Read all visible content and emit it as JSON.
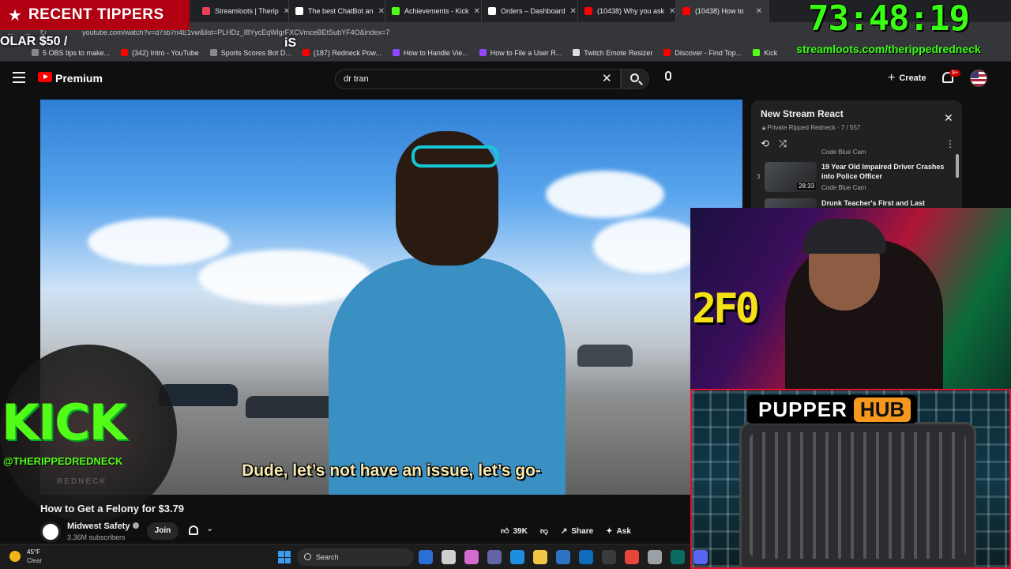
{
  "overlay": {
    "tippers_title": "RECENT TIPPERS",
    "tipper_amount": "OLAR $50 /",
    "tipper_fragment": "iS",
    "timer": "73:48:19",
    "timer_url": "streamloots.com/therippedredneck"
  },
  "browser": {
    "tabs": [
      {
        "label": "Streamloots | Therip",
        "color": "#e84057"
      },
      {
        "label": "The best ChatBot an",
        "color": "#ffffff"
      },
      {
        "label": "Achievements - Kick",
        "color": "#53fc18"
      },
      {
        "label": "Orders – Dashboard",
        "color": "#ffffff"
      },
      {
        "label": "(10438) Why you ask",
        "color": "#ff0000"
      },
      {
        "label": "(10438) How to",
        "color": "#ff0000"
      }
    ],
    "url": "youtube.com/watch?v=d7sb7n4E1vw&list=PLHDz_I8YycEqWlgrFXCVmceBEtSubYF4O&index=7",
    "bookmarks": [
      {
        "label": "5 OBS tips to make...",
        "color": "#888888"
      },
      {
        "label": "(342) Intro - YouTube",
        "color": "#ff0000"
      },
      {
        "label": "Sports Scores Bot D...",
        "color": "#888888"
      },
      {
        "label": "(187) Redneck Pow...",
        "color": "#ff0000"
      },
      {
        "label": "How to Handle Vie...",
        "color": "#9146ff"
      },
      {
        "label": "How to File a User R...",
        "color": "#9146ff"
      },
      {
        "label": "Twitch Emote Resizer",
        "color": "#dddddd"
      },
      {
        "label": "Discover - Find Top...",
        "color": "#ff0000"
      },
      {
        "label": "Kick",
        "color": "#53fc18"
      }
    ]
  },
  "youtube": {
    "brand": "Premium",
    "search_value": "dr tran",
    "create_label": "Create",
    "notif_count": "9+"
  },
  "video": {
    "subtitle": "Dude, let’s not have an issue, let’s go-",
    "title": "How to Get a Felony for $3.79",
    "channel": "Midwest Safety",
    "subscribers": "3.36M subscribers",
    "join_label": "Join",
    "likes": "39K",
    "share_label": "Share",
    "ask_label": "Ask"
  },
  "kick_overlay": {
    "logo": "KICK",
    "handle": "@THERIPPEDREDNECK",
    "sub": "REDNECK"
  },
  "playlist": {
    "title": "New Stream React",
    "subtitle": "Private Ripped Redneck - 7 / 557",
    "partial_channel": "Code Blue Cam",
    "items": [
      {
        "index": "3",
        "title": "19 Year Old Impaired Driver Crashes into Police Officer",
        "channel": "Code Blue Cam",
        "duration": "28:33"
      },
      {
        "index": "",
        "title": "Drunk Teacher's First and Last",
        "channel": "",
        "duration": ""
      }
    ]
  },
  "webcam": {
    "sign": "2F0"
  },
  "pupper": {
    "label_a": "PUPPER",
    "label_b": "HUB"
  },
  "taskbar": {
    "temp": "45°F",
    "condition": "Clear",
    "search_placeholder": "Search",
    "apps": [
      "#2b6fd6",
      "#cfcfcf",
      "#d36bd1",
      "#6264a7",
      "#1d8fe1",
      "#f2c744",
      "#2c73c4",
      "#0f6cbd",
      "#3b3b3b",
      "#e8453c",
      "#9aa0a6",
      "#0b6b62",
      "#5865f2"
    ]
  }
}
